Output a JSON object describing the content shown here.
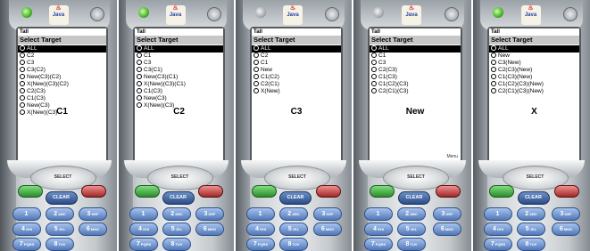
{
  "phones": [
    {
      "led": "green",
      "status": {
        "signal": "Tall",
        "battery": ""
      },
      "title": "Select Target",
      "items": [
        "ALL",
        "C2",
        "C3",
        "C3(C2)",
        "New(C3)(C2)",
        "X(New)(C3)(C2)",
        "C2(C3)",
        "C1(C3)",
        "New(C3)",
        "X(New)(C3)"
      ],
      "selected_index": 0,
      "caption": "C1",
      "command": "",
      "keys": {
        "select": "SELECT",
        "clear": "CLEAR"
      }
    },
    {
      "led": "green",
      "status": {
        "signal": "Tall",
        "battery": ""
      },
      "title": "Select Target",
      "items": [
        "ALL",
        "C1",
        "C3",
        "C3(C1)",
        "New(C3)(C1)",
        "X(New)(C3)(C1)",
        "C1(C3)",
        "New(C3)",
        "X(New)(C3)"
      ],
      "selected_index": 0,
      "caption": "C2",
      "command": "",
      "keys": {
        "select": "SELECT",
        "clear": "CLEAR"
      }
    },
    {
      "led": "grey",
      "status": {
        "signal": "Tall",
        "battery": ""
      },
      "title": "Select Target",
      "items": [
        "ALL",
        "C2",
        "C1",
        "New",
        "C1(C2)",
        "C2(C1)",
        "X(New)"
      ],
      "selected_index": 0,
      "caption": "C3",
      "command": "",
      "keys": {
        "select": "SELECT",
        "clear": "CLEAR"
      }
    },
    {
      "led": "grey",
      "status": {
        "signal": "Tall",
        "battery": ""
      },
      "title": "Select Target",
      "items": [
        "ALL",
        "C1",
        "C3",
        "C2(C3)",
        "C1(C3)",
        "C1(C2)(C3)",
        "C2(C1)(C3)"
      ],
      "selected_index": 0,
      "caption": "New",
      "command": "Menu",
      "keys": {
        "select": "SELECT",
        "clear": "CLEAR"
      }
    },
    {
      "led": "green",
      "status": {
        "signal": "Tall",
        "battery": ""
      },
      "title": "Select Target",
      "items": [
        "ALL",
        "New",
        "C3(New)",
        "C2(C3)(New)",
        "C1(C3)(New)",
        "C1(C2)(C3)(New)",
        "C2(C1)(C3)(New)"
      ],
      "selected_index": 0,
      "caption": "X",
      "command": "",
      "keys": {
        "select": "SELECT",
        "clear": "CLEAR"
      }
    }
  ],
  "numkeys": [
    {
      "digit": "1",
      "letters": ""
    },
    {
      "digit": "2",
      "letters": "ABC"
    },
    {
      "digit": "3",
      "letters": "DEF"
    },
    {
      "digit": "4",
      "letters": "GHI"
    },
    {
      "digit": "5",
      "letters": "JKL"
    },
    {
      "digit": "6",
      "letters": "MNO"
    },
    {
      "digit": "7",
      "letters": "PQRS"
    },
    {
      "digit": "8",
      "letters": "TUV"
    }
  ]
}
